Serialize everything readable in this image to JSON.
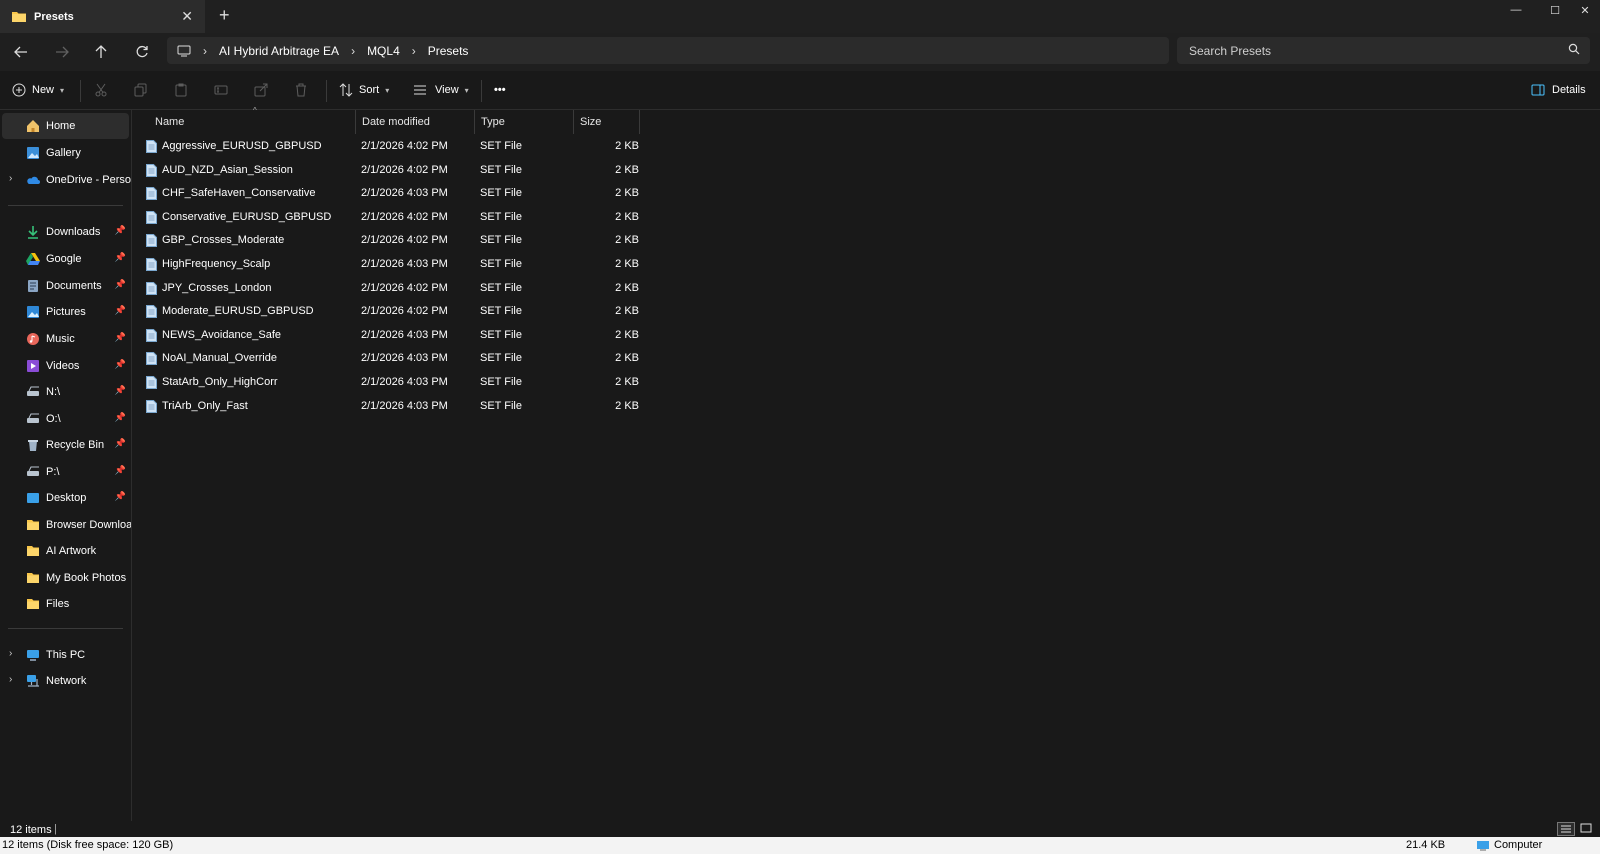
{
  "tab": {
    "title": "Presets"
  },
  "window_controls": {
    "minimize": "—",
    "maximize": "☐",
    "close": "✕"
  },
  "address": {
    "crumbs": [
      "AI Hybrid Arbitrage EA",
      "MQL4",
      "Presets"
    ],
    "search_placeholder": "Search Presets"
  },
  "commands": {
    "new_label": "New",
    "sort_label": "Sort",
    "view_label": "View",
    "more_label": "•••",
    "details_label": "Details"
  },
  "sidebar": {
    "top": [
      {
        "label": "Home",
        "icon": "home-icon"
      },
      {
        "label": "Gallery",
        "icon": "gallery-icon"
      },
      {
        "label": "OneDrive - Persona",
        "icon": "onedrive-icon"
      }
    ],
    "quick": [
      {
        "label": "Downloads",
        "icon": "download-icon"
      },
      {
        "label": "Google",
        "icon": "google-drive-icon"
      },
      {
        "label": "Documents",
        "icon": "documents-icon"
      },
      {
        "label": "Pictures",
        "icon": "pictures-icon"
      },
      {
        "label": "Music",
        "icon": "music-icon"
      },
      {
        "label": "Videos",
        "icon": "videos-icon"
      },
      {
        "label": "N:\\",
        "icon": "network-drive-icon"
      },
      {
        "label": "O:\\",
        "icon": "network-drive-icon"
      },
      {
        "label": "Recycle Bin",
        "icon": "recycle-bin-icon"
      },
      {
        "label": "P:\\",
        "icon": "network-drive-icon"
      },
      {
        "label": "Desktop",
        "icon": "desktop-icon"
      },
      {
        "label": "Browser Downloads",
        "icon": "folder-icon"
      },
      {
        "label": "AI Artwork",
        "icon": "folder-icon"
      },
      {
        "label": "My Book Photos",
        "icon": "folder-icon"
      },
      {
        "label": "Files",
        "icon": "folder-icon"
      }
    ],
    "bottom": [
      {
        "label": "This PC",
        "icon": "this-pc-icon"
      },
      {
        "label": "Network",
        "icon": "network-icon"
      }
    ]
  },
  "columns": [
    "Name",
    "Date modified",
    "Type",
    "Size"
  ],
  "files": [
    {
      "name": "Aggressive_EURUSD_GBPUSD",
      "date": "2/1/2026 4:02 PM",
      "type": "SET File",
      "size": "2 KB"
    },
    {
      "name": "AUD_NZD_Asian_Session",
      "date": "2/1/2026 4:02 PM",
      "type": "SET File",
      "size": "2 KB"
    },
    {
      "name": "CHF_SafeHaven_Conservative",
      "date": "2/1/2026 4:03 PM",
      "type": "SET File",
      "size": "2 KB"
    },
    {
      "name": "Conservative_EURUSD_GBPUSD",
      "date": "2/1/2026 4:02 PM",
      "type": "SET File",
      "size": "2 KB"
    },
    {
      "name": "GBP_Crosses_Moderate",
      "date": "2/1/2026 4:02 PM",
      "type": "SET File",
      "size": "2 KB"
    },
    {
      "name": "HighFrequency_Scalp",
      "date": "2/1/2026 4:03 PM",
      "type": "SET File",
      "size": "2 KB"
    },
    {
      "name": "JPY_Crosses_London",
      "date": "2/1/2026 4:02 PM",
      "type": "SET File",
      "size": "2 KB"
    },
    {
      "name": "Moderate_EURUSD_GBPUSD",
      "date": "2/1/2026 4:02 PM",
      "type": "SET File",
      "size": "2 KB"
    },
    {
      "name": "NEWS_Avoidance_Safe",
      "date": "2/1/2026 4:03 PM",
      "type": "SET File",
      "size": "2 KB"
    },
    {
      "name": "NoAI_Manual_Override",
      "date": "2/1/2026 4:03 PM",
      "type": "SET File",
      "size": "2 KB"
    },
    {
      "name": "StatArb_Only_HighCorr",
      "date": "2/1/2026 4:03 PM",
      "type": "SET File",
      "size": "2 KB"
    },
    {
      "name": "TriArb_Only_Fast",
      "date": "2/1/2026 4:03 PM",
      "type": "SET File",
      "size": "2 KB"
    }
  ],
  "status": {
    "count": "12 items",
    "disk": "12 items (Disk free space: 120 GB)",
    "size": "21.4 KB",
    "location": "Computer"
  },
  "colors": {
    "accent": "#4cc2ff",
    "folder": "#f8c64a",
    "background": "#191919"
  }
}
